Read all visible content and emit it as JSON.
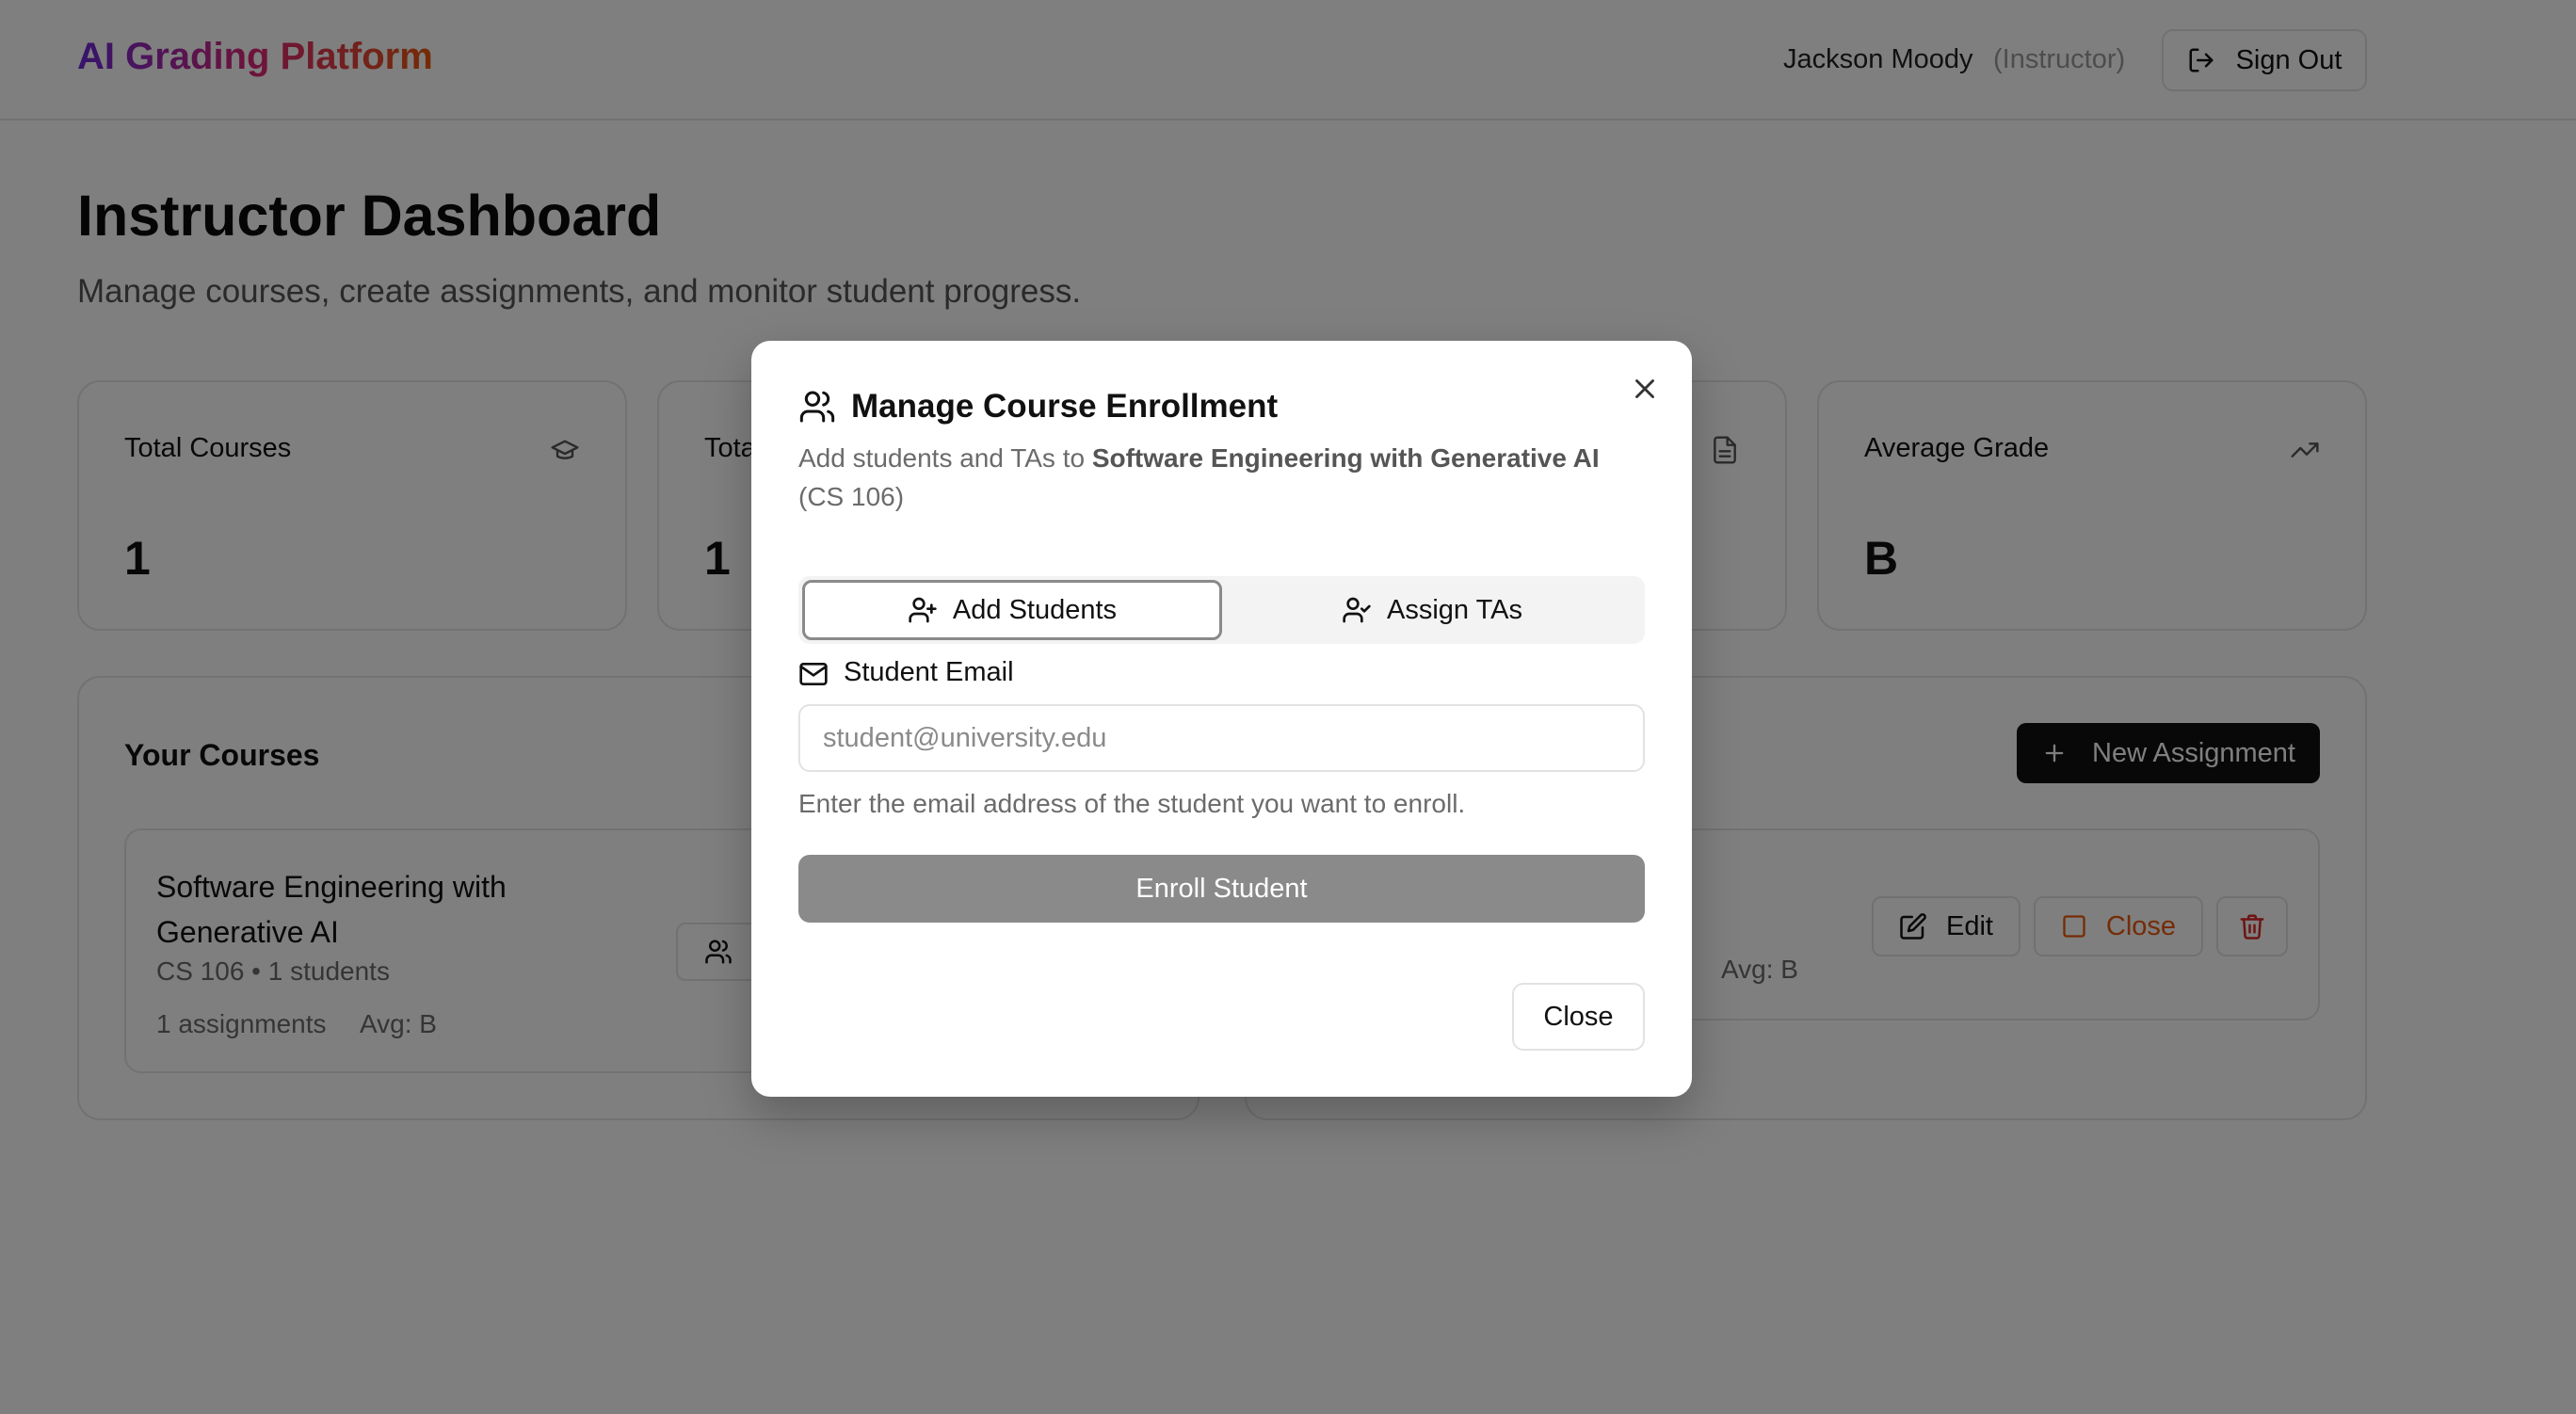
{
  "header": {
    "logo": "AI Grading Platform",
    "user_name": "Jackson Moody",
    "user_role": "(Instructor)",
    "signout_label": "Sign Out"
  },
  "page": {
    "title": "Instructor Dashboard",
    "subtitle": "Manage courses, create assignments, and monitor student progress."
  },
  "stats": [
    {
      "label": "Total Courses",
      "value": "1",
      "icon": "graduation-cap-icon"
    },
    {
      "label": "Tota",
      "value": "1",
      "icon": "users-icon"
    },
    {
      "label": "",
      "value": "",
      "icon": "file-text-icon"
    },
    {
      "label": "Average Grade",
      "value": "B",
      "icon": "trending-up-icon"
    }
  ],
  "courses": {
    "title": "Your Courses",
    "items": [
      {
        "name": "Software Engineering with Generative AI",
        "meta": "CS 106 • 1 students",
        "assignments": "1 assignments",
        "avg": "Avg: B"
      }
    ]
  },
  "assignments": {
    "new_label": "New Assignment",
    "items": [
      {
        "avg": "Avg: B",
        "edit_label": "Edit",
        "close_label": "Close"
      }
    ]
  },
  "modal": {
    "title": "Manage Course Enrollment",
    "desc_prefix": "Add students and TAs to ",
    "course_name": "Software Engineering with Generative AI",
    "course_code": "(CS 106)",
    "tabs": [
      {
        "label": "Add Students",
        "active": true
      },
      {
        "label": "Assign TAs",
        "active": false
      }
    ],
    "email_label": "Student Email",
    "email_placeholder": "student@university.edu",
    "email_value": "",
    "email_help": "Enter the email address of the student you want to enroll.",
    "enroll_label": "Enroll Student",
    "close_label": "Close"
  },
  "colors": {
    "overlay": "rgba(0,0,0,0.5)",
    "primary": "#111111",
    "danger": "#ea580c",
    "delete": "#dc2626"
  }
}
